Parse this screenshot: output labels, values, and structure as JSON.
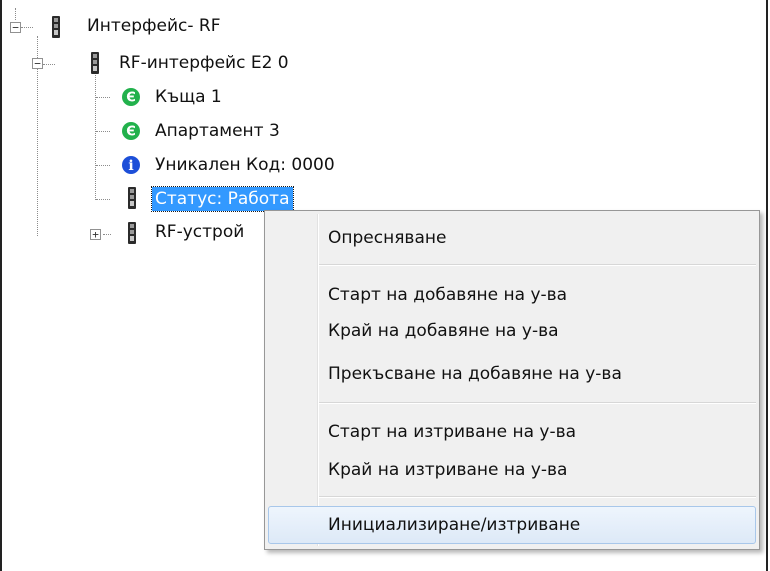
{
  "tree": {
    "root_label": "Интерфейс- RF",
    "interface_label": "RF-интерфейс E2 0",
    "children": [
      {
        "label": "Къща 1",
        "icon": "e-green-icon"
      },
      {
        "label": "Апартамент 3",
        "icon": "e-green-icon"
      },
      {
        "label": "Уникален Код: 0000",
        "icon": "info-blue-icon"
      },
      {
        "label": "Статус: Работа",
        "icon": "device-icon",
        "selected": true
      }
    ],
    "devices_label": "RF-устрой"
  },
  "context_menu": {
    "items": [
      "Опресняване",
      "Старт на добавяне на у-ва",
      "Край на добавяне на у-ва",
      "Прекъсване на добавяне на у-ва",
      "Старт на изтриване на у-ва",
      "Край на изтриване на у-ва",
      "Инициализиране/изтриване"
    ],
    "highlighted_item": "Инициализиране/изтриване"
  },
  "colors": {
    "selection": "#3399ff",
    "icon_green": "#22b14c",
    "icon_blue": "#1d4fd8",
    "menu_bg": "#f0f0f0"
  }
}
